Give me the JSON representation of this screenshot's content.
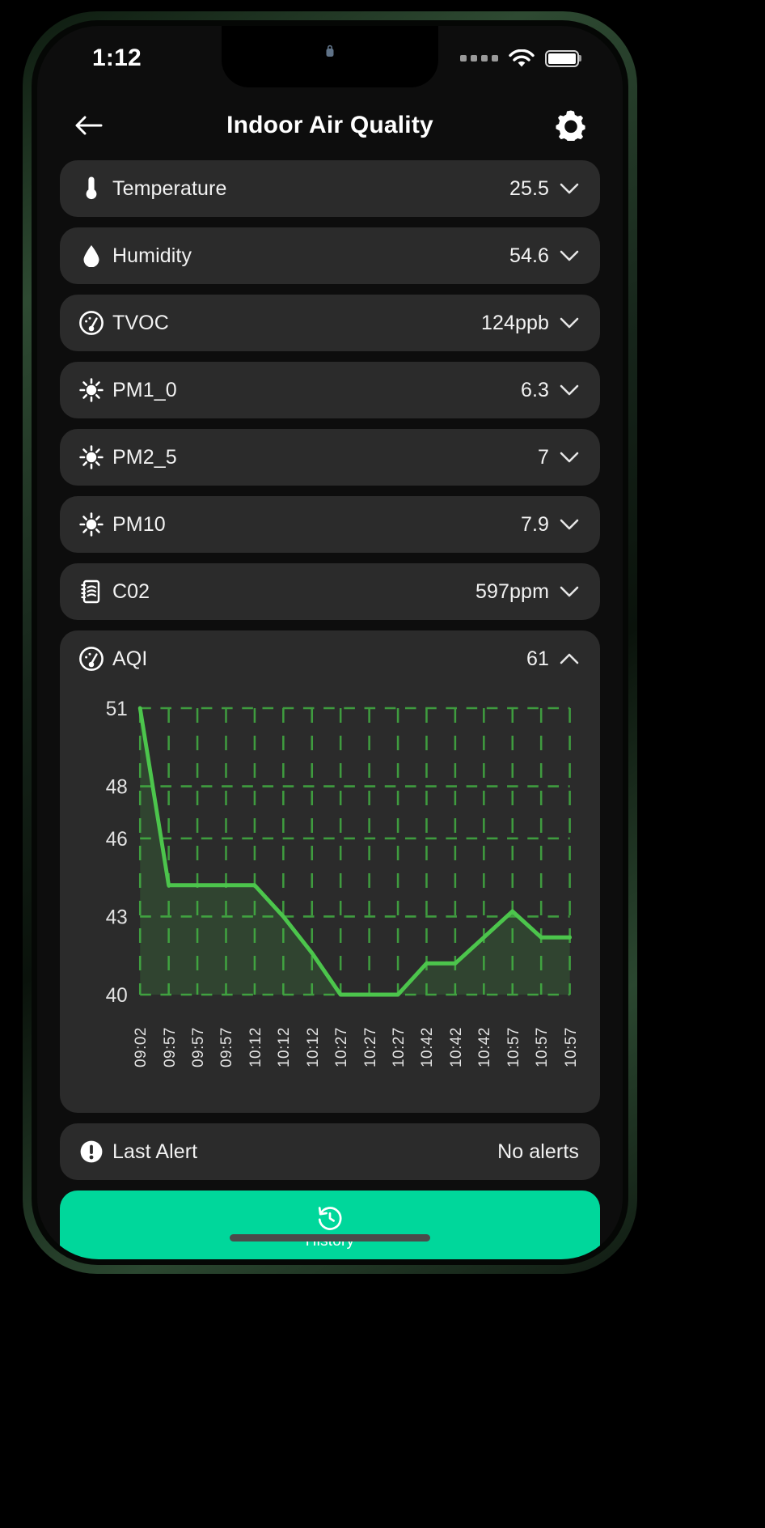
{
  "status_bar": {
    "time": "1:12",
    "signal_icon": "signal-dots-icon",
    "wifi_icon": "wifi-icon",
    "battery_icon": "battery-full-icon"
  },
  "header": {
    "back_icon": "arrow-left-icon",
    "title": "Indoor Air Quality",
    "settings_icon": "gear-icon"
  },
  "sensors": [
    {
      "icon": "thermometer-icon",
      "label": "Temperature",
      "value": "25.5",
      "expanded": false
    },
    {
      "icon": "water-drop-icon",
      "label": "Humidity",
      "value": "54.6",
      "expanded": false
    },
    {
      "icon": "gauge-icon",
      "label": "TVOC",
      "value": "124ppb",
      "expanded": false
    },
    {
      "icon": "particle-icon",
      "label": "PM1_0",
      "value": "6.3",
      "expanded": false
    },
    {
      "icon": "particle-icon",
      "label": "PM2_5",
      "value": "7",
      "expanded": false
    },
    {
      "icon": "particle-icon",
      "label": "PM10",
      "value": "7.9",
      "expanded": false
    },
    {
      "icon": "co2-icon",
      "label": "C02",
      "value": "597ppm",
      "expanded": false
    }
  ],
  "aqi": {
    "icon": "gauge-icon",
    "label": "AQI",
    "value": "61",
    "chevron": "chevron-up-icon",
    "expanded": true
  },
  "alert": {
    "icon": "exclamation-circle-icon",
    "label": "Last Alert",
    "value": "No alerts"
  },
  "history_button": {
    "icon": "history-clock-icon",
    "label": "History"
  },
  "colors": {
    "accent": "#00d79b",
    "chart_line": "#4cc54c",
    "chart_grid": "#3f9c3f",
    "card_bg": "#2b2b2b",
    "screen_bg": "#0d0d0d",
    "text": "#f2f2f2"
  },
  "chart_data": {
    "type": "area",
    "title": "AQI",
    "xlabel": "",
    "ylabel": "",
    "grid": true,
    "legend": "none",
    "ylim": [
      40,
      51
    ],
    "yticks": [
      40,
      43,
      46,
      48,
      51
    ],
    "categories": [
      "09:02",
      "09:57",
      "09:57",
      "09:57",
      "10:12",
      "10:12",
      "10:12",
      "10:27",
      "10:27",
      "10:27",
      "10:42",
      "10:42",
      "10:42",
      "10:57",
      "10:57",
      "10:57"
    ],
    "series": [
      {
        "name": "AQI",
        "values": [
          51,
          44.2,
          44.2,
          44.2,
          44.2,
          43,
          41.6,
          40,
          40,
          40,
          41.2,
          41.2,
          42.2,
          43.2,
          42.2,
          42.2
        ]
      }
    ]
  }
}
